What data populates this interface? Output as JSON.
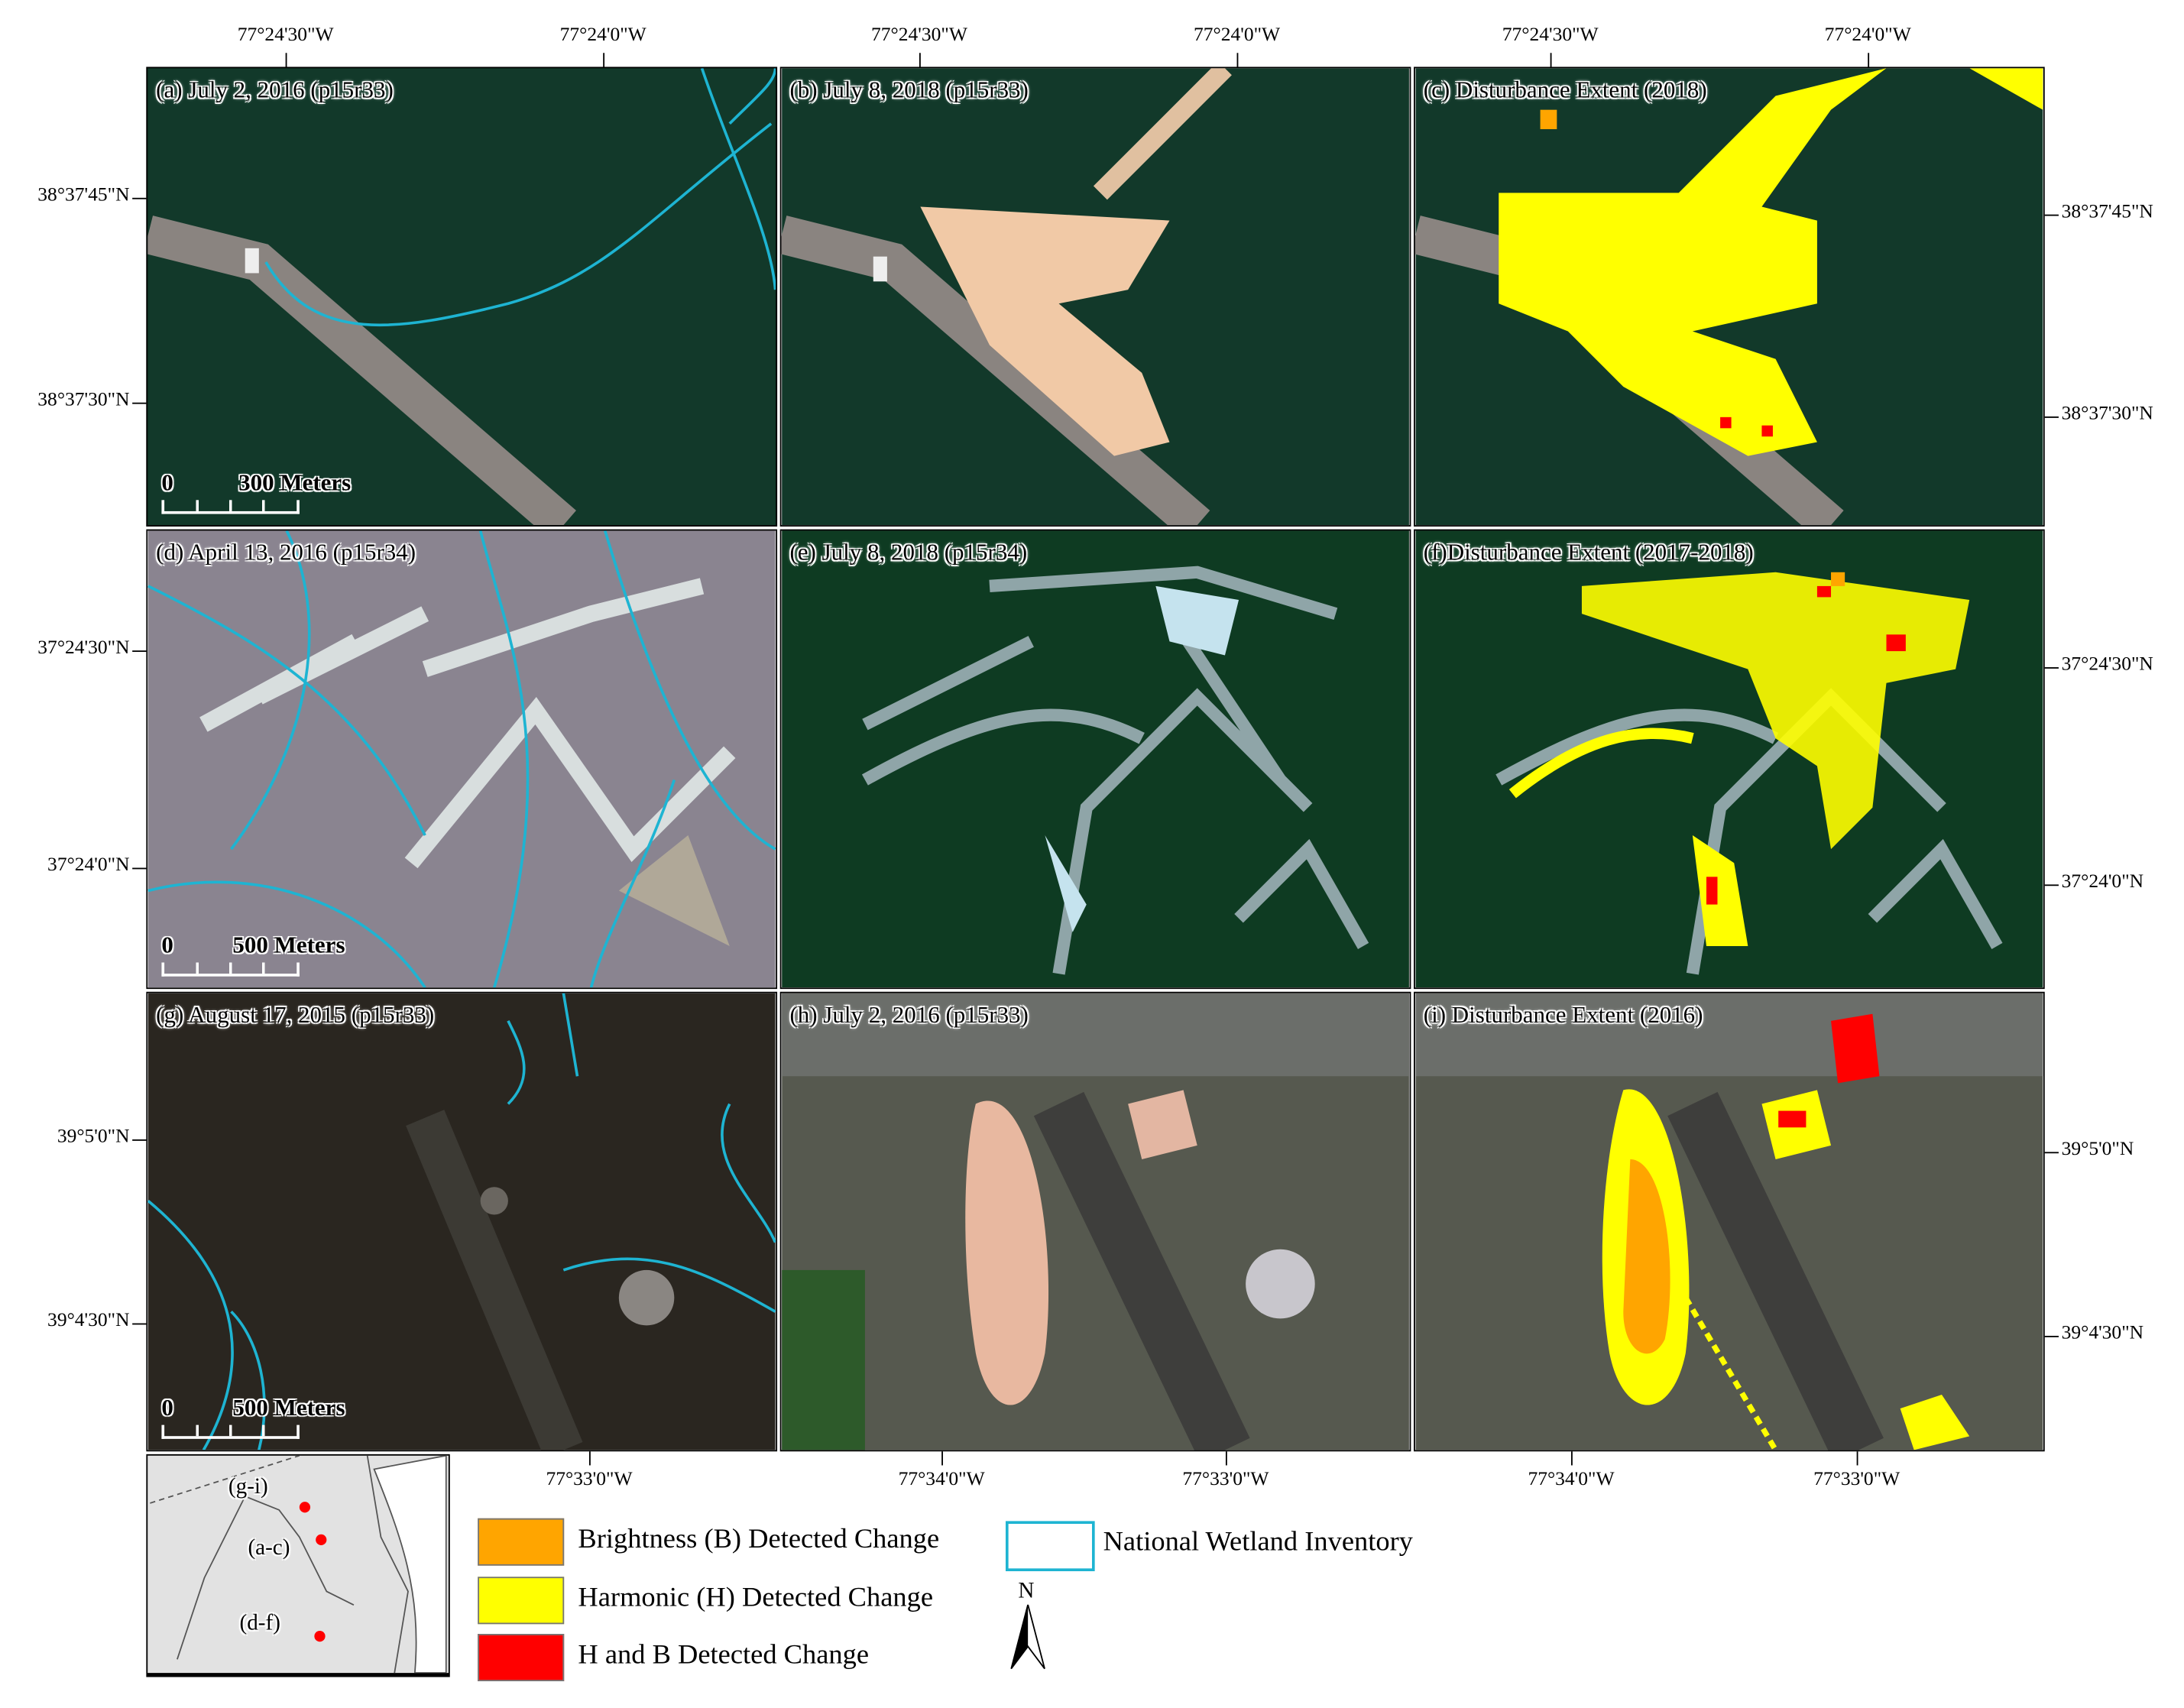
{
  "panels": [
    {
      "label": "(a) July 2, 2016 (p15r33)"
    },
    {
      "label": "(b) July 8, 2018 (p15r33)"
    },
    {
      "label": "(c) Disturbance Extent (2018)"
    },
    {
      "label": "(d) April 13, 2016 (p15r34)"
    },
    {
      "label": "(e) July 8, 2018 (p15r34)"
    },
    {
      "label": "(f)Disturbance Extent (2017-2018)"
    },
    {
      "label": "(g) August 17, 2015 (p15r33)"
    },
    {
      "label": "(h) July 2, 2016 (p15r33)"
    },
    {
      "label": "(i) Disturbance Extent (2016)"
    }
  ],
  "scale_bars": [
    {
      "zero": "0",
      "label": "300 Meters"
    },
    {
      "zero": "0",
      "label": "500 Meters"
    },
    {
      "zero": "0",
      "label": "500 Meters"
    }
  ],
  "ticks": {
    "top": [
      "77°24'30\"W",
      "77°24'0\"W",
      "77°24'30\"W",
      "77°24'0\"W",
      "77°24'30\"W",
      "77°24'0\"W"
    ],
    "left": [
      "38°37'45\"N",
      "38°37'30\"N",
      "37°24'30\"N",
      "37°24'0\"N",
      "39°5'0\"N",
      "39°4'30\"N"
    ],
    "right": [
      "38°37'45\"N",
      "38°37'30\"N",
      "37°24'30\"N",
      "37°24'0\"N",
      "39°5'0\"N",
      "39°4'30\"N"
    ],
    "bottom": [
      "77°33'0\"W",
      "77°34'0\"W",
      "77°33'0\"W",
      "77°34'0\"W",
      "77°33'0\"W"
    ]
  },
  "inset": {
    "labels": [
      "(g-i)",
      "(a-c)",
      "(d-f)"
    ]
  },
  "legend": {
    "items": [
      {
        "label": "Brightness (B) Detected Change",
        "color": "#FFA500"
      },
      {
        "label": "Harmonic (H) Detected Change",
        "color": "#FFFF00"
      },
      {
        "label": "H and B Detected Change",
        "color": "#FF0000"
      },
      {
        "label": "National Wetland Inventory",
        "color": "#1EB4D2"
      }
    ],
    "north": "N"
  }
}
